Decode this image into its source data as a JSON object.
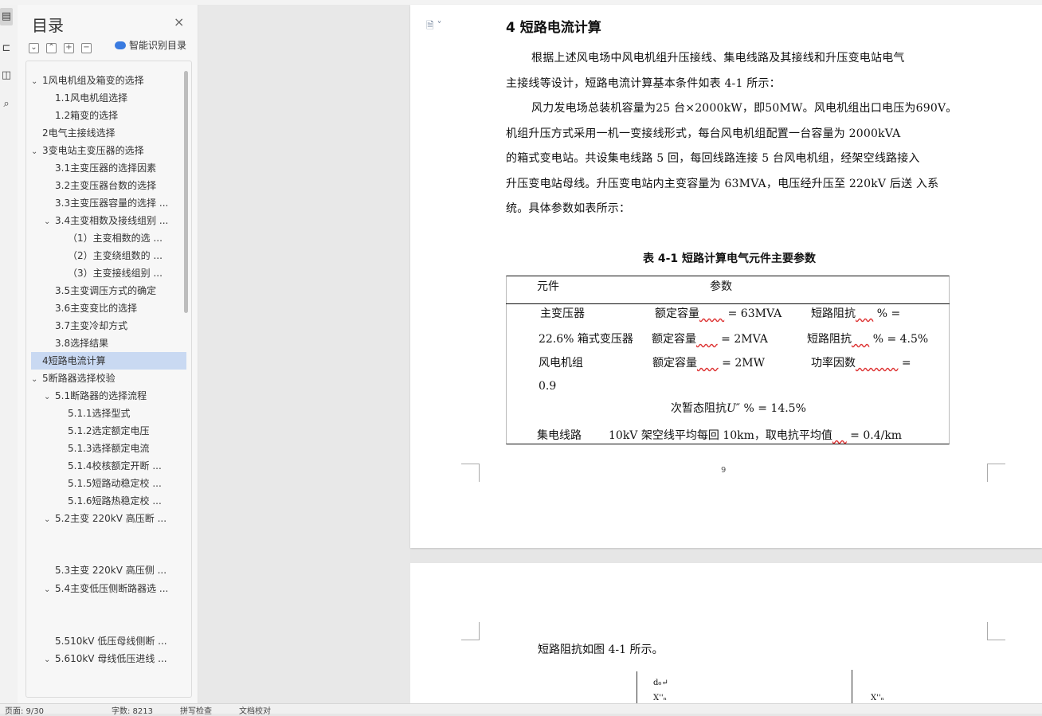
{
  "rail": {
    "icons": [
      "toc-icon",
      "chapter-icon",
      "bookmark-icon",
      "find-icon"
    ]
  },
  "nav": {
    "title": "目录",
    "close": "×",
    "tools": [
      "⌄",
      "⌃",
      "+",
      "−"
    ],
    "smart_label": "智能识别目录",
    "items": [
      {
        "label": "1风电机组及箱变的选择",
        "chev": "v"
      },
      {
        "label": "1.1风电机组选择",
        "chev": ""
      },
      {
        "label": "1.2箱变的选择",
        "chev": ""
      },
      {
        "label": "2电气主接线选择",
        "chev": ""
      },
      {
        "label": "3变电站主变压器的选择",
        "chev": "v"
      },
      {
        "label": "3.1主变压器的选择因素",
        "chev": ""
      },
      {
        "label": "3.2主变压器台数的选择",
        "chev": ""
      },
      {
        "label": "3.3主变压器容量的选择 ...",
        "chev": ""
      },
      {
        "label": "3.4主变相数及接线组别 ...",
        "chev": "v"
      },
      {
        "label": "（1）主变相数的选 ...",
        "chev": ""
      },
      {
        "label": "（2）主变绕组数的 ...",
        "chev": ""
      },
      {
        "label": "（3）主变接线组别 ...",
        "chev": ""
      },
      {
        "label": "3.5主变调压方式的确定",
        "chev": ""
      },
      {
        "label": "3.6主变变比的选择",
        "chev": ""
      },
      {
        "label": "3.7主变冷却方式",
        "chev": ""
      },
      {
        "label": "3.8选择结果",
        "chev": ""
      },
      {
        "label": "4短路电流计算",
        "chev": ""
      },
      {
        "label": "5断路器选择校验",
        "chev": "v"
      },
      {
        "label": "5.1断路器的选择流程",
        "chev": "v"
      },
      {
        "label": "5.1.1选择型式",
        "chev": ""
      },
      {
        "label": "5.1.2选定额定电压",
        "chev": ""
      },
      {
        "label": "5.1.3选择额定电流",
        "chev": ""
      },
      {
        "label": "5.1.4校核额定开断 ...",
        "chev": ""
      },
      {
        "label": "5.1.5短路动稳定校 ...",
        "chev": ""
      },
      {
        "label": "5.1.6短路热稳定校 ...",
        "chev": ""
      },
      {
        "label": "5.2主变 220kV 高压断 ...",
        "chev": "v"
      },
      {
        "label": "5.3主变 220kV 高压侧 ...",
        "chev": ""
      },
      {
        "label": "5.4主变低压侧断路器选 ...",
        "chev": "v"
      },
      {
        "label": "5.510kV 低压母线侧断 ...",
        "chev": ""
      },
      {
        "label": "5.610kV 母线低压进线 ...",
        "chev": "v"
      }
    ]
  },
  "doc": {
    "heading": "4 短路电流计算",
    "para1": [
      "根据上述风电场中风电机组升压接线、集电线路及其接线和升压变电站电气",
      "主接线等设计，短路电流计算基本条件如表 4-1 所示："
    ],
    "para2": [
      "风力发电场总装机容量为25 台×2000kW，即50MW。风电机组出口电压为690V。",
      "机组升压方式采用一机一变接线形式，每台风电机组配置一台容量为 2000kVA",
      "的箱式变电站。共设集电线路 5 回，每回线路连接 5 台风电机组，经架空线路接入",
      "升压变电站母线。升压变电站内主变容量为 63MVA，电压经升压至 220kV 后送 入系",
      "统。具体参数如表所示："
    ],
    "table_caption": "表 4-1 短路计算电气元件主要参数",
    "table": {
      "h_comp": "元件",
      "h_param": "参数",
      "r1a": "主变压器",
      "r1b": "额定容量",
      "r1c": "= 63MVA",
      "r1d": "短路阻抗",
      "r1e": "% =",
      "r2a": "22.6% 箱式变压器",
      "r2b": "额定容量",
      "r2c": "= 2MVA",
      "r2d": "短路阻抗",
      "r2e": "% = 4.5%",
      "r3a": "风电机组",
      "r3b": "额定容量",
      "r3c": "= 2MW",
      "r3d": "功率因数",
      "r3e": "=",
      "r4a": "0.9",
      "r5a": "次暂态阻抗",
      "r5b": "U″",
      "r5c": "% = 14.5%",
      "r6a": "集电线路",
      "r6b": "10kV 架空线平均每回 10km，取电抗平均值",
      "r6c": "= 0.4/km"
    },
    "page_number": "9",
    "page2_text": "短路阻抗如图 4-1 所示。",
    "fig": {
      "d6": "d₆↵",
      "x1": "X''ₙ",
      "x2": "X''ₙ"
    }
  },
  "status": {
    "left": "页面: 9/30",
    "mid1": "字数: 8213",
    "mid2": "拼写检查",
    "mid3": "文档校对"
  }
}
